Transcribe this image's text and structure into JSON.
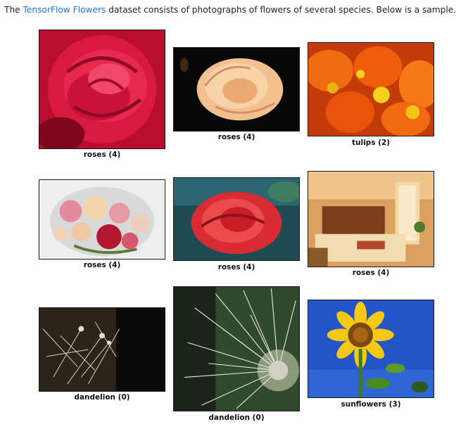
{
  "intro": {
    "prefix": "The ",
    "link_text": "TensorFlow Flowers",
    "suffix": " dataset consists of photographs of flowers of several species. Below is a sample."
  },
  "samples": [
    {
      "label": "roses (4)",
      "subject": "red-rose-closeup"
    },
    {
      "label": "roses (4)",
      "subject": "peach-rose-on-black"
    },
    {
      "label": "tulips (2)",
      "subject": "orange-tulips"
    },
    {
      "label": "roses (4)",
      "subject": "rose-bouquet"
    },
    {
      "label": "roses (4)",
      "subject": "red-rose-teal-background"
    },
    {
      "label": "roses (4)",
      "subject": "hotel-bedroom"
    },
    {
      "label": "dandelion (0)",
      "subject": "dandelion-seeds-dark"
    },
    {
      "label": "dandelion (0)",
      "subject": "dandelion-seed-head"
    },
    {
      "label": "sunflowers (3)",
      "subject": "sunflower-blue-sky"
    }
  ]
}
